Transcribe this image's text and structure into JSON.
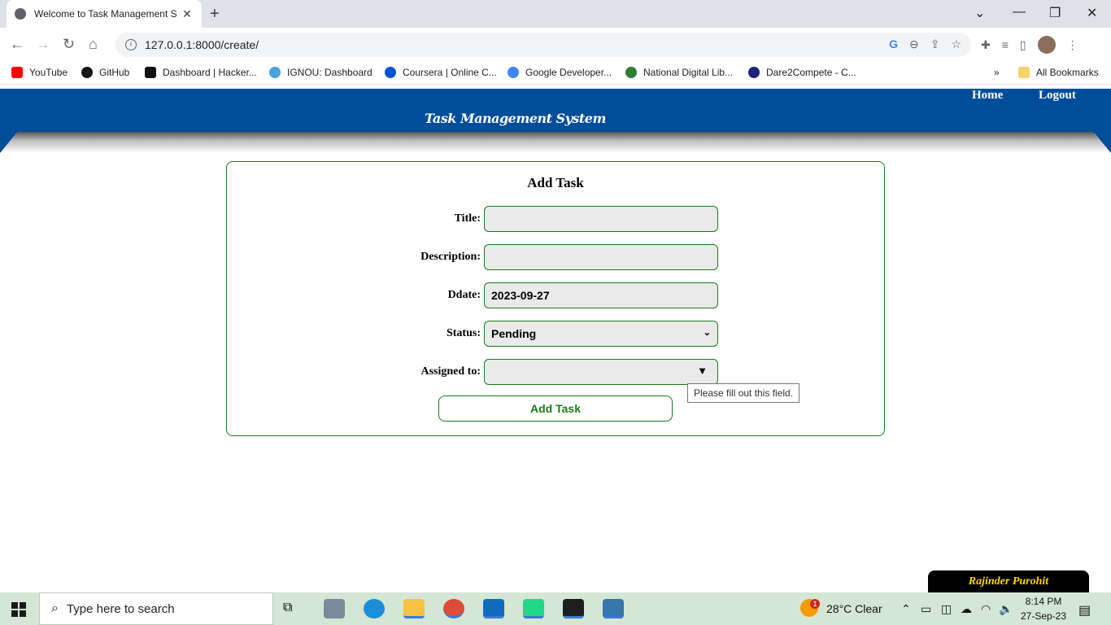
{
  "browser": {
    "tab_title": "Welcome to Task Management S",
    "url": "127.0.0.1:8000/create/",
    "bookmarks": [
      {
        "label": "YouTube",
        "color": "#ff0000"
      },
      {
        "label": "GitHub",
        "color": "#181717"
      },
      {
        "label": "Dashboard | Hacker...",
        "color": "#111111"
      },
      {
        "label": "IGNOU: Dashboard",
        "color": "#4aa3df"
      },
      {
        "label": "Coursera | Online C...",
        "color": "#0056d2"
      },
      {
        "label": "Google Developer...",
        "color": "#4285f4"
      },
      {
        "label": "National Digital Lib...",
        "color": "#2e7d32"
      },
      {
        "label": "Dare2Compete - C...",
        "color": "#1a237e"
      }
    ],
    "all_bookmarks": "All Bookmarks"
  },
  "header": {
    "site_title": "Task Management System",
    "nav": {
      "home": "Home",
      "logout": "Logout"
    },
    "banner_color": "#004d99"
  },
  "form": {
    "heading": "Add Task",
    "title_label": "Title:",
    "title_value": "",
    "description_label": "Description:",
    "description_value": "",
    "ddate_label": "Ddate:",
    "ddate_value": "2023-09-27",
    "status_label": "Status:",
    "status_value": "Pending",
    "assigned_label": "Assigned to:",
    "assigned_value": "",
    "submit_label": "Add Task",
    "validation_tooltip": "Please fill out this field.",
    "accent_color": "#1a7a1a"
  },
  "signature": "Rajinder Purohit",
  "taskbar": {
    "search_placeholder": "Type here to search",
    "weather": "28°C  Clear",
    "weather_badge": "1",
    "time": "8:14 PM",
    "date": "27-Sep-23"
  }
}
